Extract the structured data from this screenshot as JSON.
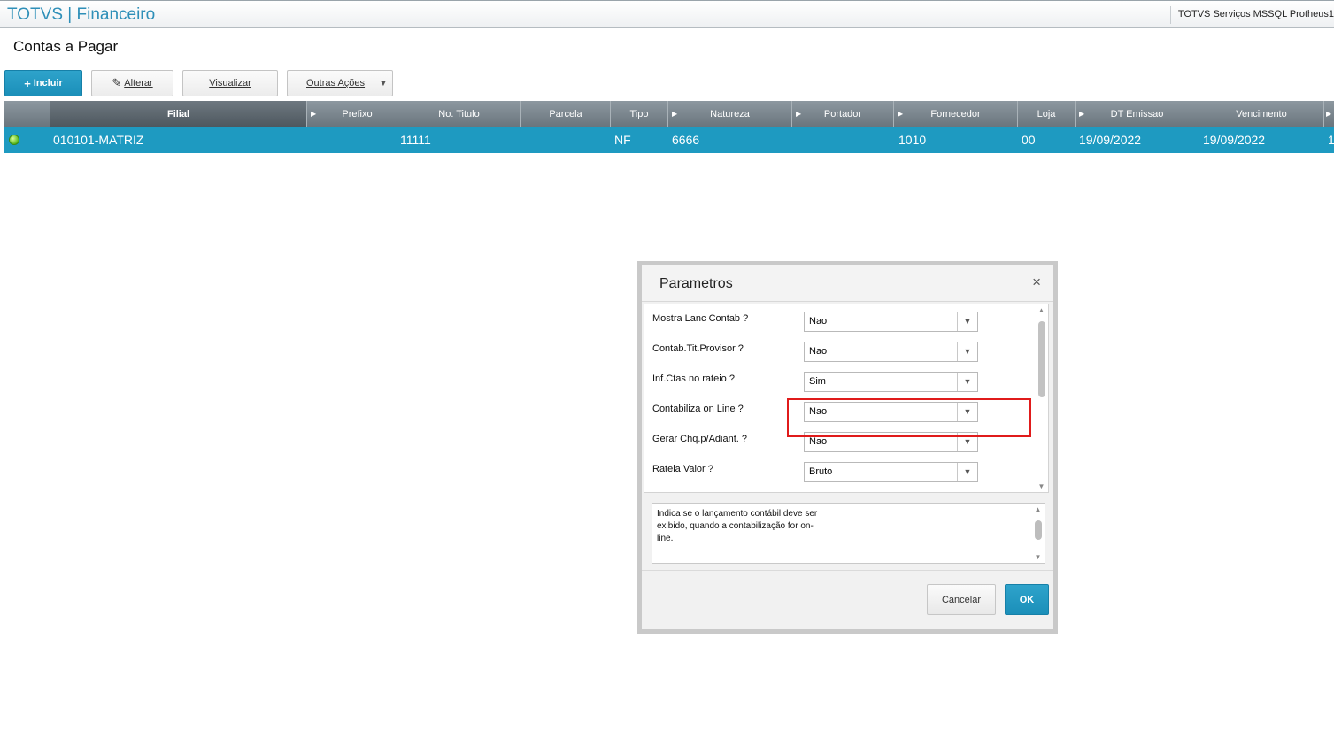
{
  "app": {
    "title": "TOTVS | Financeiro",
    "server_info": "TOTVS Serviços MSSQL Protheus1"
  },
  "page": {
    "title": "Contas a Pagar"
  },
  "toolbar": {
    "incluir_label": "Incluir",
    "alterar_label": "Alterar",
    "visualizar_label": "Visualizar",
    "outras_label": "Outras Ações"
  },
  "grid": {
    "columns": [
      "Filial",
      "Prefixo",
      "No. Titulo",
      "Parcela",
      "Tipo",
      "Natureza",
      "Portador",
      "Fornecedor",
      "Loja",
      "DT Emissao",
      "Vencimento"
    ],
    "rows": [
      {
        "filial": "010101-MATRIZ",
        "prefixo": "",
        "no_titulo": "11111",
        "parcela": "",
        "tipo": "NF",
        "natureza": "6666",
        "portador": "",
        "fornecedor": "1010",
        "loja": "00",
        "dt_emissao": "19/09/2022",
        "vencimento": "19/09/2022",
        "extra": "1"
      }
    ]
  },
  "dialog": {
    "title": "Parametros",
    "close_symbol": "×",
    "params": [
      {
        "label": "Mostra Lanc Contab ?",
        "value": "Nao"
      },
      {
        "label": "Contab.Tit.Provisor ?",
        "value": "Nao"
      },
      {
        "label": "Inf.Ctas no rateio ?",
        "value": "Sim"
      },
      {
        "label": "Contabiliza on Line ?",
        "value": "Nao"
      },
      {
        "label": "Gerar Chq.p/Adiant. ?",
        "value": "Nao"
      },
      {
        "label": "Rateia Valor ?",
        "value": "Bruto"
      }
    ],
    "help_text": "Indica se o lançamento contábil deve ser exibido, quando a contabilização for on-line.",
    "cancel_label": "Cancelar",
    "ok_label": "OK"
  },
  "colors": {
    "accent": "#1e9ac1",
    "header_gray": "#7a858c",
    "highlight_red": "#e01b1b",
    "status_green": "#58b81e"
  },
  "icons": [
    "plus-icon",
    "pencil-icon",
    "dropdown-arrow-icon",
    "status-dot-icon",
    "close-icon",
    "scroll-up-icon",
    "scroll-down-icon"
  ]
}
